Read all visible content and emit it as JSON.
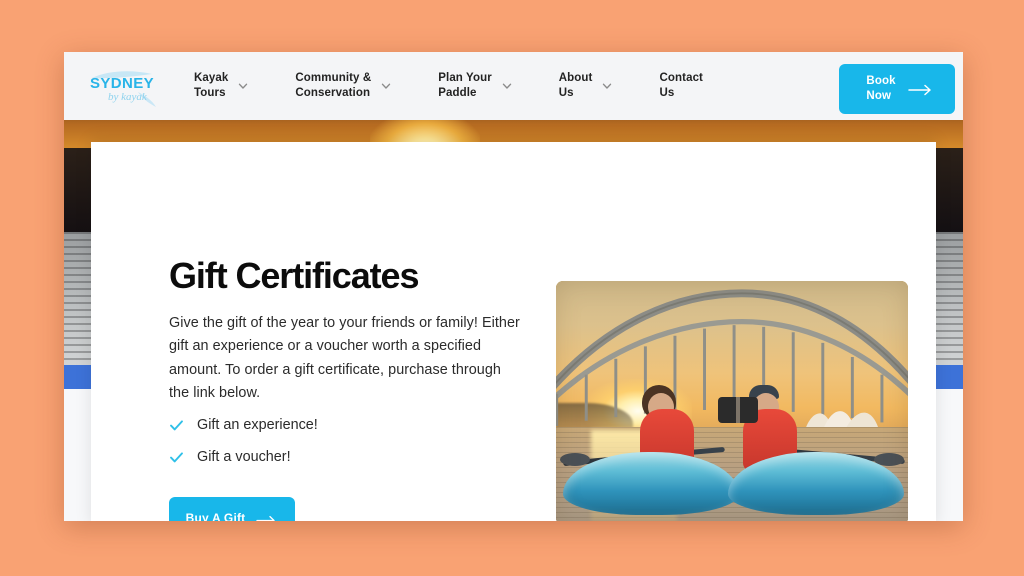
{
  "page": {
    "background_color": "#F9A273",
    "accent_color": "#18B7EA",
    "blue_band_color": "#3D72D8",
    "nav_background": "#F4F5F7"
  },
  "navbar": {
    "logo": {
      "line1": "SYDNEY",
      "line2": "by kayak",
      "icon": "kayak-paddle-logo"
    },
    "items": [
      {
        "label": "Kayak\nTours",
        "has_dropdown": true,
        "icon": "chevron-down-icon"
      },
      {
        "label": "Community &\nConservation",
        "has_dropdown": true,
        "icon": "chevron-down-icon"
      },
      {
        "label": "Plan Your\nPaddle",
        "has_dropdown": true,
        "icon": "chevron-down-icon"
      },
      {
        "label": "About\nUs",
        "has_dropdown": true,
        "icon": "chevron-down-icon"
      },
      {
        "label": "Contact\nUs",
        "has_dropdown": false,
        "icon": ""
      }
    ],
    "cta": {
      "label": "Book\nNow",
      "icon": "arrow-right-icon",
      "color": "#18B7EA"
    }
  },
  "main": {
    "title": "Gift Certificates",
    "paragraph": "Give the gift of the year to your friends or family! Either gift an experience or a voucher worth a specified amount. To order a gift certificate, purchase through the link below.",
    "benefits": [
      {
        "icon": "check-icon",
        "label": "Gift an experience!"
      },
      {
        "icon": "check-icon",
        "label": "Gift a voucher!"
      }
    ],
    "cta": {
      "label": "Buy A Gift",
      "icon": "arrow-right-icon",
      "color": "#18B7EA"
    },
    "photo": {
      "alt": "Two kayakers toasting drinks at sunset in front of the Sydney Harbour Bridge and Opera House",
      "name": "kayakers-sunset-photo"
    }
  }
}
